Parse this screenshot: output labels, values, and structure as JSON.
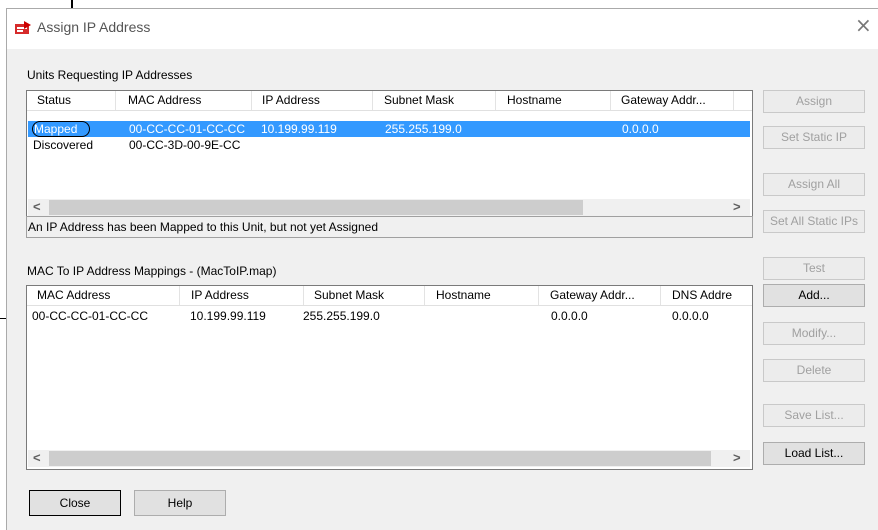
{
  "window": {
    "title": "Assign IP Address",
    "close_glyph": "×"
  },
  "units_group": {
    "caption": "Units Requesting IP Addresses",
    "columns": [
      "Status",
      "MAC Address",
      "IP Address",
      "Subnet Mask",
      "Hostname",
      "Gateway Addr..."
    ],
    "rows": [
      {
        "status": "Mapped",
        "mac": "00-CC-CC-01-CC-CC",
        "ip": "10.199.99.119",
        "mask": "255.255.199.0",
        "hostname": "",
        "gateway": "0.0.0.0",
        "selected": true
      },
      {
        "status": "Discovered",
        "mac": "00-CC-3D-00-9E-CC",
        "ip": "",
        "mask": "",
        "hostname": "",
        "gateway": "",
        "selected": false
      }
    ],
    "status_message": "An IP Address has been Mapped to this Unit, but not yet Assigned"
  },
  "mappings_group": {
    "caption": "MAC To IP Address Mappings - (MacToIP.map)",
    "columns": [
      "MAC Address",
      "IP Address",
      "Subnet Mask",
      "Hostname",
      "Gateway Addr...",
      "DNS Addre"
    ],
    "rows": [
      {
        "mac": "00-CC-CC-01-CC-CC",
        "ip": "10.199.99.119",
        "mask": "255.255.199.0",
        "hostname": "",
        "gateway": "0.0.0.0",
        "dns": "0.0.0.0"
      }
    ]
  },
  "buttons": {
    "assign": "Assign",
    "set_static_ip": "Set Static IP",
    "assign_all": "Assign All",
    "set_all_static": "Set All Static IPs",
    "test": "Test",
    "add": "Add...",
    "modify": "Modify...",
    "delete": "Delete",
    "save_list": "Save List...",
    "load_list": "Load List...",
    "close": "Close",
    "help": "Help"
  },
  "scroll": {
    "left_arrow": "<",
    "right_arrow": ">"
  },
  "colors": {
    "selection": "#3399ff",
    "disabled_text": "#a0a0a0"
  }
}
